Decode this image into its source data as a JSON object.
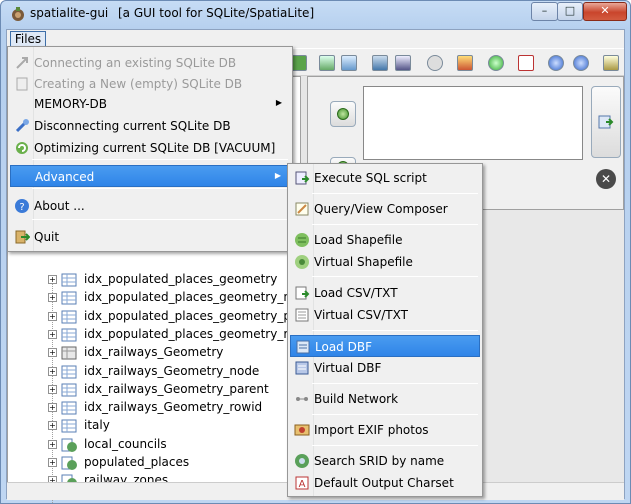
{
  "window": {
    "app_name": "spatialite-gui",
    "subtitle": "[a GUI tool for SQLite/SpatiaLite]",
    "controls": {
      "minimize": "–",
      "maximize": "□",
      "close": "✕"
    }
  },
  "menubar": {
    "files_label": "Files"
  },
  "files_menu": {
    "items": [
      {
        "label": "Connecting an existing SQLite DB",
        "icon": "connect-db-icon",
        "disabled": true
      },
      {
        "label": "Creating a New (empty) SQLite DB",
        "icon": "new-db-icon",
        "disabled": true
      },
      {
        "label": "MEMORY-DB",
        "icon": "",
        "submenu": true
      },
      {
        "label": "Disconnecting current SQLite DB",
        "icon": "disconnect-db-icon"
      },
      {
        "label": "Optimizing current SQLite DB [VACUUM]",
        "icon": "vacuum-icon"
      },
      {
        "label": "Advanced",
        "icon": "",
        "submenu": true,
        "selected": true
      },
      {
        "label": "About ...",
        "icon": "about-icon"
      },
      {
        "label": "Quit",
        "icon": "quit-icon"
      }
    ]
  },
  "advanced_menu": {
    "items": [
      {
        "label": "Execute SQL script",
        "icon": "sql-script-icon"
      },
      {
        "label": "Query/View Composer",
        "icon": "query-composer-icon"
      },
      {
        "label": "Load Shapefile",
        "icon": "load-shapefile-icon"
      },
      {
        "label": "Virtual Shapefile",
        "icon": "virtual-shapefile-icon"
      },
      {
        "label": "Load CSV/TXT",
        "icon": "load-csv-icon"
      },
      {
        "label": "Virtual CSV/TXT",
        "icon": "virtual-csv-icon"
      },
      {
        "label": "Load DBF",
        "icon": "load-dbf-icon",
        "selected": true
      },
      {
        "label": "Virtual DBF",
        "icon": "virtual-dbf-icon"
      },
      {
        "label": "Build Network",
        "icon": "network-icon"
      },
      {
        "label": "Import EXIF photos",
        "icon": "exif-icon"
      },
      {
        "label": "Search SRID by name",
        "icon": "srid-search-icon"
      },
      {
        "label": "Default Output Charset",
        "icon": "charset-icon"
      }
    ]
  },
  "tree": {
    "items": [
      {
        "label": "idx_populated_places_geometry",
        "icon": "table-icon"
      },
      {
        "label": "idx_populated_places_geometry_node",
        "icon": "table-icon"
      },
      {
        "label": "idx_populated_places_geometry_parent",
        "icon": "table-icon"
      },
      {
        "label": "idx_populated_places_geometry_rowid",
        "icon": "table-icon"
      },
      {
        "label": "idx_railways_Geometry",
        "icon": "spatial-index-icon"
      },
      {
        "label": "idx_railways_Geometry_node",
        "icon": "table-icon"
      },
      {
        "label": "idx_railways_Geometry_parent",
        "icon": "table-icon"
      },
      {
        "label": "idx_railways_Geometry_rowid",
        "icon": "table-icon"
      },
      {
        "label": "italy",
        "icon": "table-icon"
      },
      {
        "label": "local_councils",
        "icon": "geometry-table-icon"
      },
      {
        "label": "populated_places",
        "icon": "geometry-table-icon"
      },
      {
        "label": "railway_zones",
        "icon": "geometry-table-icon"
      }
    ],
    "expander": "+"
  },
  "scrollbar": {
    "left_arrow": "◀",
    "right_arrow": "▶",
    "grip": "|||"
  },
  "sql_panel": {
    "clear_symbol": "✕"
  },
  "colors": {
    "selection": "#3388ec",
    "title_bg": "#c6dcf5"
  }
}
